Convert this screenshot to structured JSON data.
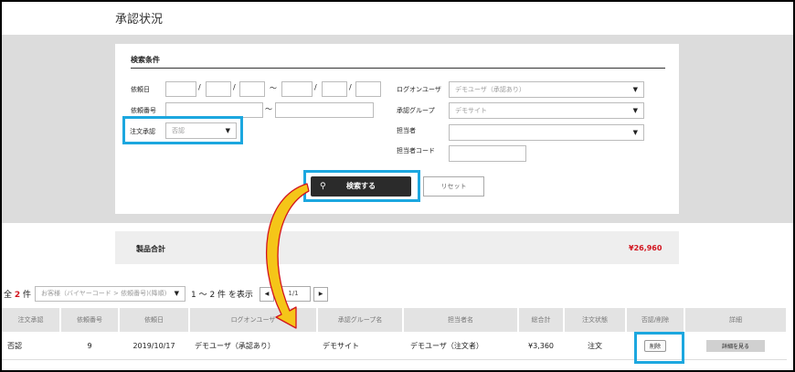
{
  "page_title": "承認状況",
  "search": {
    "heading": "検索条件",
    "labels": {
      "request_date": "依頼日",
      "request_no": "依頼番号",
      "order_approval": "注文承認",
      "login_user": "ログオンユーザ",
      "approval_group": "承認グループ",
      "person": "担当者",
      "person_code": "担当者コード"
    },
    "separators": {
      "slash": "/",
      "tilde": "～"
    },
    "order_approval_value": "否認",
    "login_user_value": "デモユーザ（承認あり）",
    "approval_group_value": "デモサイト",
    "person_value": "",
    "search_button": "検索する",
    "reset_button": "リセット"
  },
  "summary": {
    "label": "製品合計",
    "value": "¥26,960"
  },
  "results": {
    "count_prefix": "全",
    "count": "2",
    "count_suffix": "件",
    "sort_value": "お客様（バイヤーコード > 依頼番号)(降順)",
    "range_text": "1 ～ 2 件 を表示",
    "page_value": "1/1",
    "prev": "◀",
    "next": "▶"
  },
  "table": {
    "headers": [
      "注文承認",
      "依頼番号",
      "依頼日",
      "ログオンユーザ",
      "承認グループ名",
      "担当者名",
      "総合計",
      "注文状態",
      "否認/削除",
      "詳細"
    ],
    "rows": [
      {
        "approval": "否認",
        "no": "9",
        "date": "2019/10/17",
        "user": "デモユーザ（承認あり）",
        "group": "デモサイト",
        "person": "デモユーザ（注文者）",
        "total": "¥3,360",
        "status": "注文",
        "delete": "削除",
        "detail": "詳細を見る"
      }
    ]
  },
  "colors": {
    "highlight": "#1ca7df",
    "accent_red": "#d2141e",
    "arrow_fill": "#f5c518",
    "arrow_stroke": "#d2141e"
  }
}
